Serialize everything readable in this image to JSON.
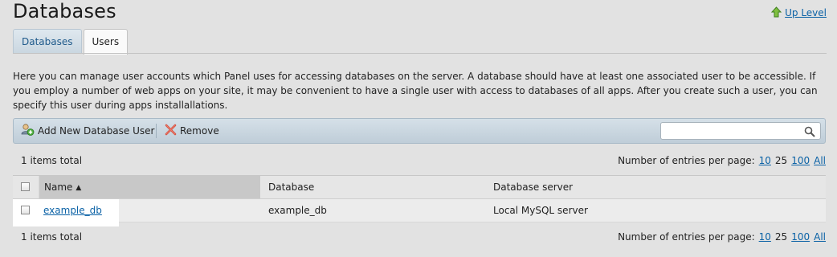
{
  "page": {
    "title": "Databases",
    "up_level": "Up Level"
  },
  "tabs": [
    {
      "label": "Databases",
      "active": false
    },
    {
      "label": "Users",
      "active": true
    }
  ],
  "description": "Here you can manage user accounts which Panel uses for accessing databases on the server. A database should have at least one associated user to be accessible. If you employ a number of web apps on your site, it may be convenient to have a single user with access to databases of all apps. After you create such a user, you can specify this user during apps installallations.",
  "toolbar": {
    "add_label": "Add New Database User",
    "remove_label": "Remove",
    "search_placeholder": "",
    "search_value": ""
  },
  "pager_top": {
    "total": "1 items total",
    "label": "Number of entries per page:",
    "options": [
      "10",
      "25",
      "100",
      "All"
    ],
    "selected": "25"
  },
  "pager_bottom": {
    "total": "1 items total",
    "label": "Number of entries per page:",
    "options": [
      "10",
      "25",
      "100",
      "All"
    ],
    "selected": "25"
  },
  "table": {
    "columns": {
      "name": "Name",
      "name_sort": "▲",
      "database": "Database",
      "server": "Database server"
    },
    "rows": [
      {
        "name": "example_db",
        "database": "example_db",
        "server": "Local MySQL server"
      }
    ]
  },
  "colors": {
    "link": "#0b62a6",
    "toolbar": "#c9d6e0",
    "background": "#e2e2e2"
  }
}
